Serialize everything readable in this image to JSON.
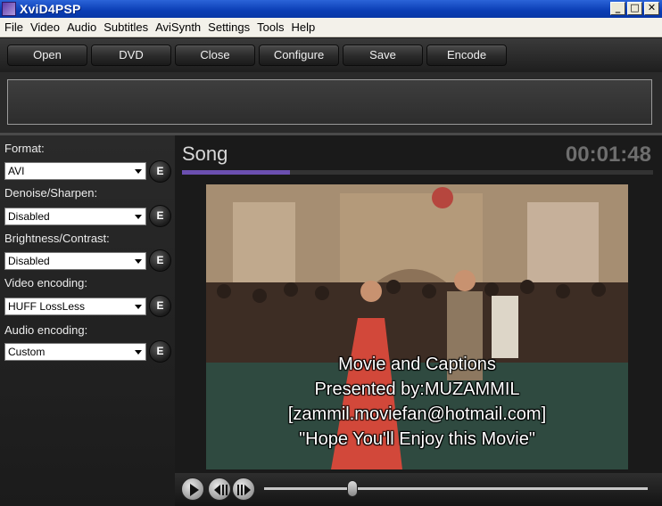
{
  "window": {
    "title": "XviD4PSP",
    "controls": {
      "minimize": "_",
      "maximize": "□",
      "close": "✕"
    }
  },
  "menu": [
    "File",
    "Video",
    "Audio",
    "Subtitles",
    "AviSynth",
    "Settings",
    "Tools",
    "Help"
  ],
  "toolbar": [
    "Open",
    "DVD",
    "Close",
    "Configure",
    "Save",
    "Encode"
  ],
  "settings": [
    {
      "label": "Format:",
      "value": "AVI",
      "edit": "E"
    },
    {
      "label": "Denoise/Sharpen:",
      "value": "Disabled",
      "edit": "E"
    },
    {
      "label": "Brightness/Contrast:",
      "value": "Disabled",
      "edit": "E"
    },
    {
      "label": "Video encoding:",
      "value": "HUFF LossLess",
      "edit": "E"
    },
    {
      "label": "Audio encoding:",
      "value": "Custom",
      "edit": "E"
    }
  ],
  "preview": {
    "title": "Song",
    "time": "00:01:48",
    "progress_fraction": 0.23,
    "captions": [
      "Movie and Captions",
      "Presented by:MUZAMMIL",
      "[zammil.moviefan@hotmail.com]",
      "\"Hope You'll  Enjoy this  Movie\""
    ]
  },
  "transport": {
    "play": "play-icon",
    "frame_back": "frame-back-icon",
    "frame_forward": "frame-forward-icon",
    "seek_fraction": 0.23
  },
  "colors": {
    "accent": "#6b4fb0",
    "titlebar": "#0a3db4"
  }
}
